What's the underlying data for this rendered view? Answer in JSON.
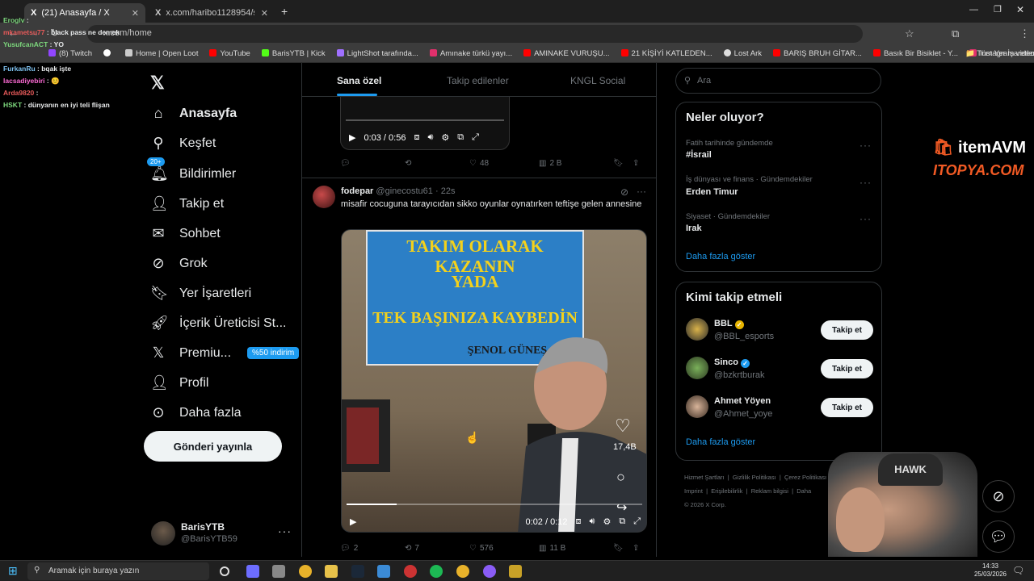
{
  "browser": {
    "tabs": [
      {
        "label": "(21) Anasayfa / X",
        "active": true
      },
      {
        "label": "x.com/haribo1128954/status/2...",
        "active": false
      }
    ],
    "url": "x.com/home",
    "bookmarks": [
      "(8) Twitch",
      "",
      "Home | Open Loot",
      "YouTube",
      "BarisYTB | Kick",
      "LightShot tarafında...",
      "Amınake türkü yayı...",
      "AMINAKE VURUŞU...",
      "21 KİŞİYİ KATLEDEN...",
      "Lost Ark",
      "BARIŞ BRUH GİTAR...",
      "Basık Bir Bisiklet - Y...",
      "Instagram videosu:..."
    ],
    "all_bookmarks": "Tüm Yer İşaretleri"
  },
  "chat": [
    {
      "user": "Eroglv",
      "msg": ""
    },
    {
      "user": "mkametsu77",
      "msg": "black pass ne demek"
    },
    {
      "user": "YusufcanACT",
      "msg": "YO"
    },
    {
      "user": "FurkanRu",
      "msg": "bqak işte"
    },
    {
      "user": "lacsadiyebiri",
      "msg": "😊"
    },
    {
      "user": "Arda9820",
      "msg": ""
    },
    {
      "user": "HSKT",
      "msg": "dünyanın en iyi teli flişan"
    }
  ],
  "nav": {
    "items": [
      "Anasayfa",
      "Keşfet",
      "Bildirimler",
      "Takip et",
      "Sohbet",
      "Grok",
      "Yer İşaretleri",
      "İçerik Üreticisi St...",
      "Premiu...",
      "Profil",
      "Daha fazla"
    ],
    "notif_badge": "20+",
    "premium_promo": "%50 indirim",
    "post_button": "Gönderi yayınla",
    "user_name": "BarisYTB",
    "user_handle": "@BarisYTB59"
  },
  "timeline": {
    "tabs": [
      "Sana özel",
      "Takip edilenler",
      "KNGL Social"
    ],
    "tweet1": {
      "video_time": "0:03 / 0:56",
      "likes": "48",
      "views": "2 B"
    },
    "tweet2": {
      "author": "fodepar",
      "handle": "@ginecostu61",
      "time": "22s",
      "text": "misafir cocuguna tarayıcıdan sikko oyunlar oynatırken teftişe gelen annesine",
      "banner_lines": [
        "TAKIM OLARAK KAZANIN",
        "YADA",
        "TEK BAŞINIZA KAYBEDİN",
        "ŞENOL GÜNEŞ"
      ],
      "overlay_likes": "17,4B",
      "video_time": "0:02 / 0:12",
      "replies": "2",
      "retweets": "7",
      "likes": "576",
      "views": "11 B",
      "progress": 0.17
    }
  },
  "right": {
    "search_placeholder": "Ara",
    "trends_title": "Neler oluyor?",
    "trends": [
      {
        "meta": "Fatih tarihinde gündemde",
        "name": "#İsrail"
      },
      {
        "meta": "İş dünyası ve finans · Gündemdekiler",
        "name": "Erden Timur"
      },
      {
        "meta": "Siyaset · Gündemdekiler",
        "name": "Irak"
      }
    ],
    "show_more": "Daha fazla göster",
    "who_title": "Kimi takip etmeli",
    "who": [
      {
        "name": "BBL",
        "handle": "@BBL_esports",
        "badge_color": "#e8b500"
      },
      {
        "name": "Sinco",
        "handle": "@bzkrtburak",
        "badge_color": "#1d9bf0"
      },
      {
        "name": "Ahmet Yöyen",
        "handle": "@Ahmet_yoye",
        "badge_color": ""
      }
    ],
    "follow_label": "Takip et",
    "footer": [
      "Hizmet Şartları",
      "Gizlilik Politikası",
      "Çerez Politikası",
      "Imprint",
      "Erişilebilirlik",
      "Reklam bilgisi",
      "Daha",
      "© 2026 X Corp."
    ]
  },
  "overlays": {
    "ad_line1": "itemAVM",
    "ad_line2": "ITOPYA.COM",
    "chair_brand": "HAWK"
  },
  "taskbar": {
    "search": "Aramak için buraya yazın",
    "time": "14:33",
    "date": "25/03/2026"
  }
}
